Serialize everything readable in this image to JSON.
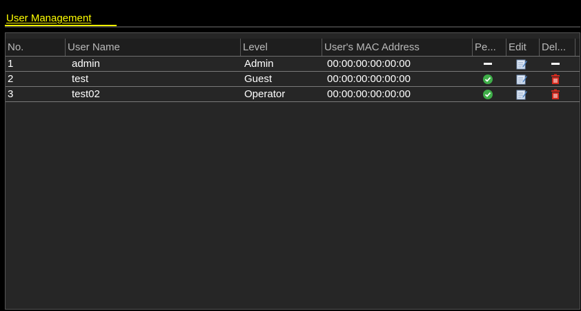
{
  "page": {
    "title": "User Management"
  },
  "table": {
    "columns": {
      "no": "No.",
      "user_name": "User Name",
      "level": "Level",
      "mac": "User's MAC Address",
      "permission": "Pe...",
      "edit": "Edit",
      "delete": "Del..."
    },
    "rows": [
      {
        "no": "1",
        "user_name": "admin",
        "level": "Admin",
        "mac": "00:00:00:00:00:00",
        "permission_icon": "dash-icon",
        "edit_icon": "edit-icon",
        "delete_icon": "dash-icon"
      },
      {
        "no": "2",
        "user_name": "test",
        "level": "Guest",
        "mac": "00:00:00:00:00:00",
        "permission_icon": "check-circle-icon",
        "edit_icon": "edit-icon",
        "delete_icon": "trash-icon"
      },
      {
        "no": "3",
        "user_name": "test02",
        "level": "Operator",
        "mac": "00:00:00:00:00:00",
        "permission_icon": "check-circle-icon",
        "edit_icon": "edit-icon",
        "delete_icon": "trash-icon"
      }
    ]
  },
  "colors": {
    "title": "#ffff00",
    "panel": "#262626",
    "check": "#3fae49",
    "trash": "#d42a1e",
    "edit": "#4a7fc1"
  }
}
